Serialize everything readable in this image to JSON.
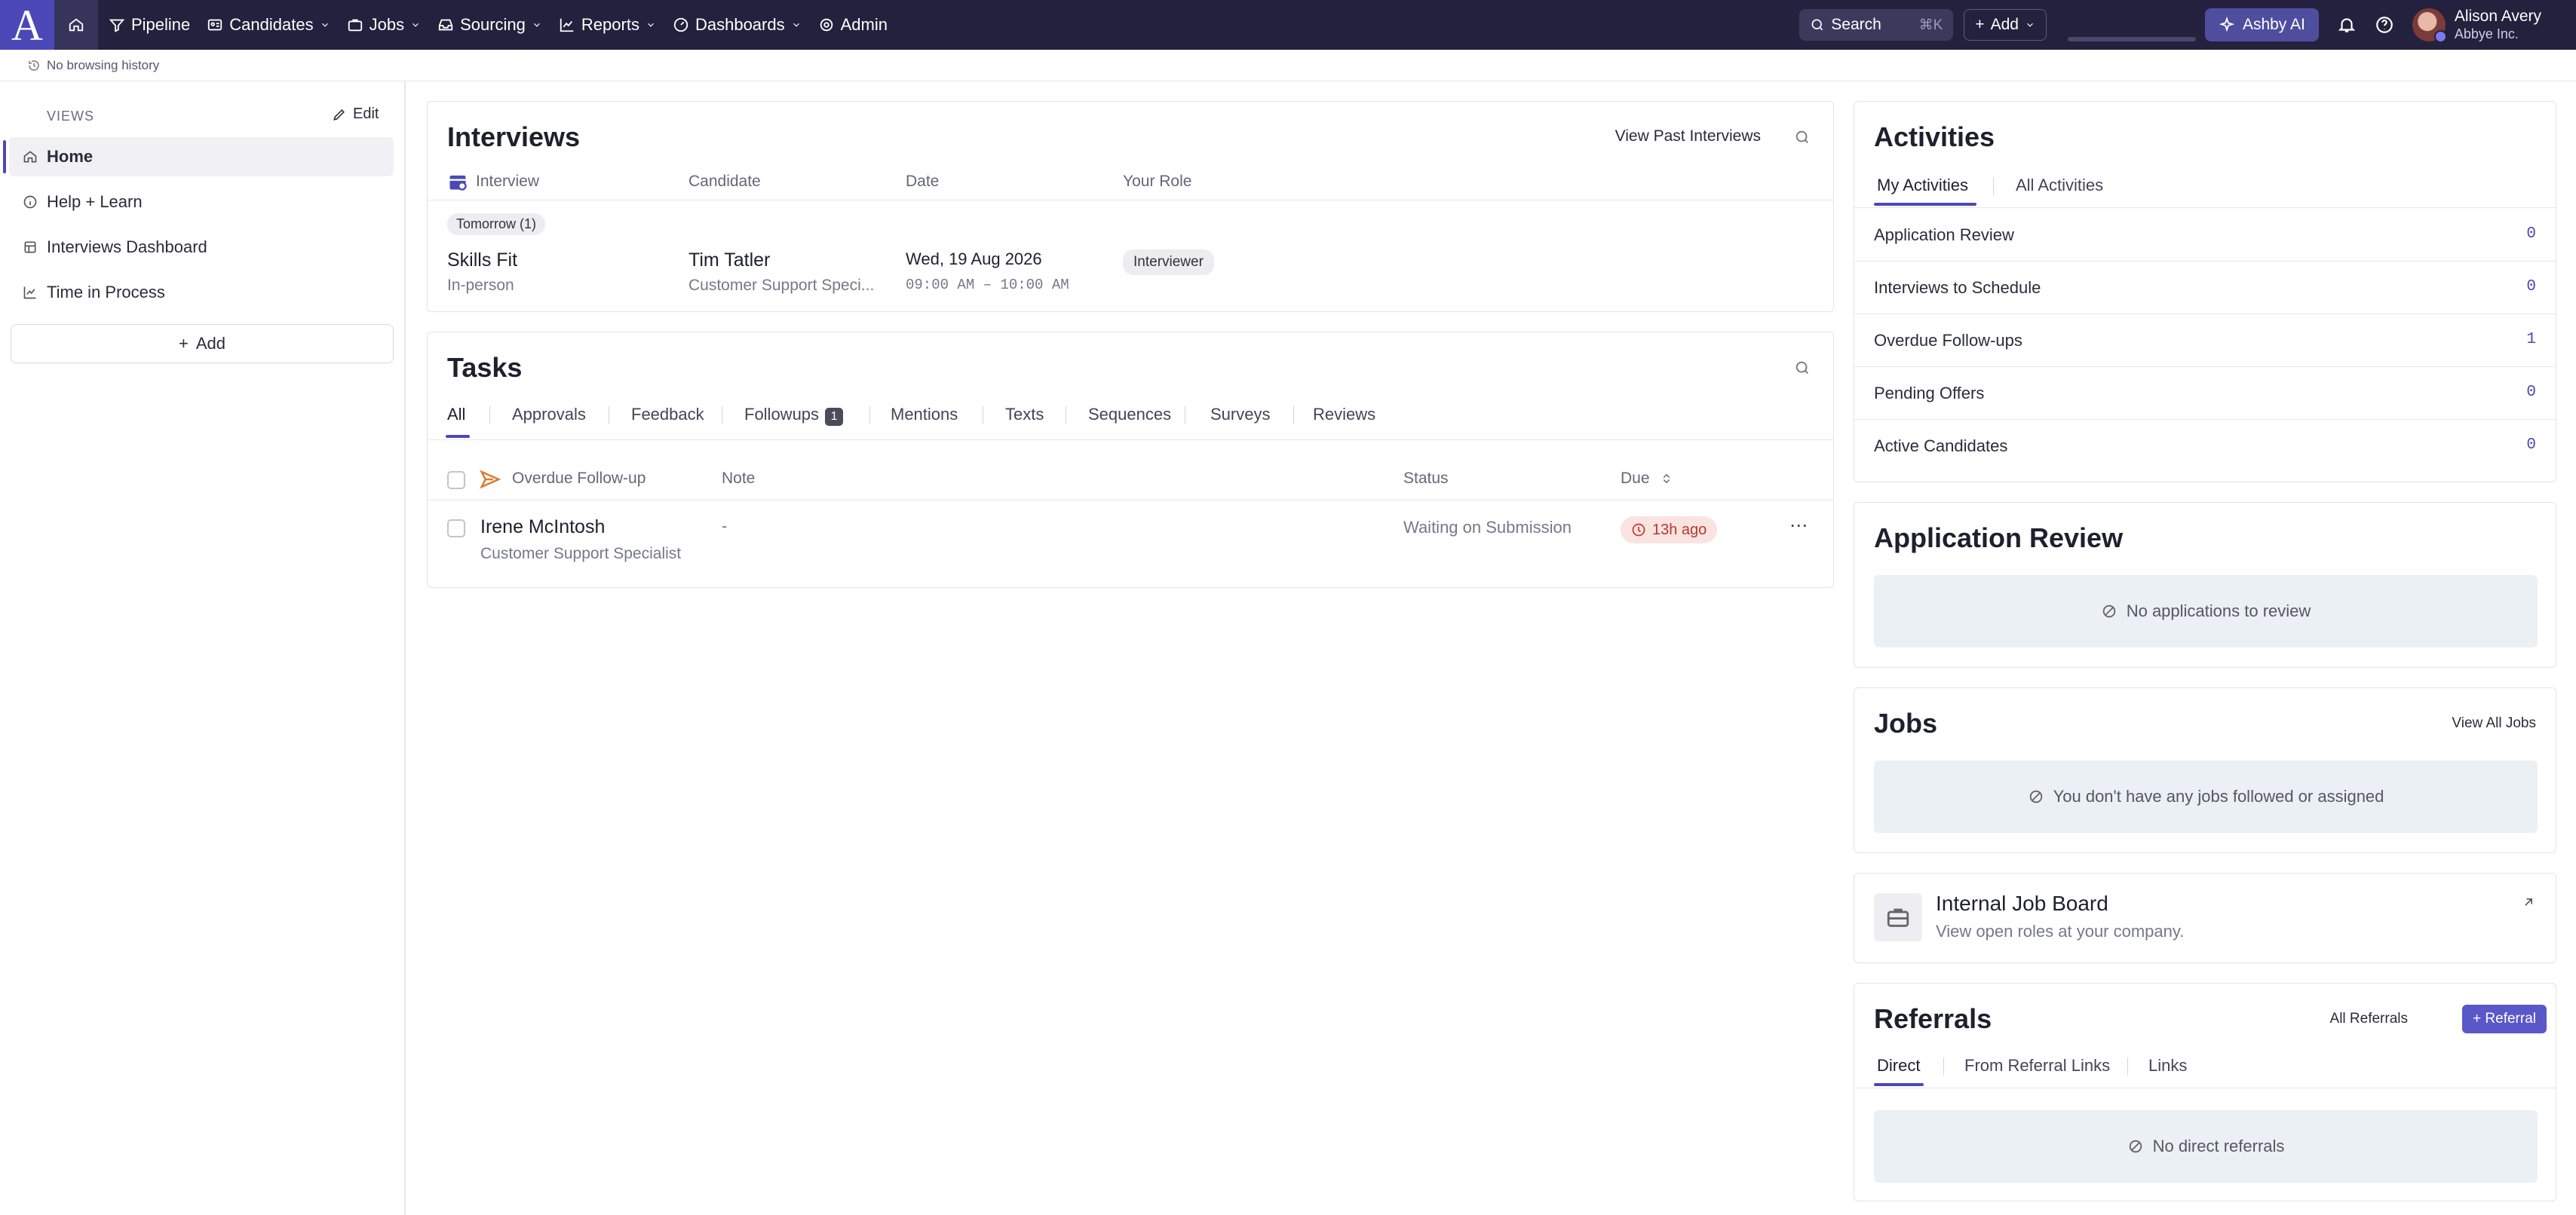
{
  "nav": {
    "logo": "A",
    "items": [
      {
        "label": "Pipeline"
      },
      {
        "label": "Candidates"
      },
      {
        "label": "Jobs"
      },
      {
        "label": "Sourcing"
      },
      {
        "label": "Reports"
      },
      {
        "label": "Dashboards"
      },
      {
        "label": "Admin"
      }
    ],
    "search_label": "Search",
    "search_shortcut": "⌘K",
    "add_label": "Add",
    "ai_label": "Ashby AI",
    "user_name": "Alison Avery",
    "user_org": "Abbye Inc."
  },
  "subbar": {
    "history": "No browsing history"
  },
  "sidebar": {
    "views_label": "VIEWS",
    "edit_label": "Edit",
    "items": [
      {
        "label": "Home"
      },
      {
        "label": "Help + Learn"
      },
      {
        "label": "Interviews Dashboard"
      },
      {
        "label": "Time in Process"
      }
    ],
    "add_label": "Add"
  },
  "interviews": {
    "title": "Interviews",
    "view_past": "View Past Interviews",
    "columns": [
      "Interview",
      "Candidate",
      "Date",
      "Your Role"
    ],
    "group_label": "Tomorrow (1)",
    "rows": [
      {
        "name": "Skills Fit",
        "type": "In-person",
        "candidate": "Tim Tatler",
        "job": "Customer Support Speci...",
        "date": "Wed, 19 Aug 2026",
        "time": "09:00 AM – 10:00 AM",
        "role": "Interviewer"
      }
    ]
  },
  "tasks": {
    "title": "Tasks",
    "tabs": [
      {
        "label": "All"
      },
      {
        "label": "Approvals"
      },
      {
        "label": "Feedback"
      },
      {
        "label": "Followups",
        "badge": "1"
      },
      {
        "label": "Mentions"
      },
      {
        "label": "Texts"
      },
      {
        "label": "Sequences"
      },
      {
        "label": "Surveys"
      },
      {
        "label": "Reviews"
      }
    ],
    "columns": [
      "Overdue Follow-up",
      "Note",
      "Status",
      "Due"
    ],
    "rows": [
      {
        "name": "Irene McIntosh",
        "job": "Customer Support Specialist",
        "note": "-",
        "status": "Waiting on Submission",
        "due": "13h ago"
      }
    ]
  },
  "activities": {
    "title": "Activities",
    "tabs": [
      {
        "label": "My Activities"
      },
      {
        "label": "All Activities"
      }
    ],
    "rows": [
      {
        "label": "Application Review",
        "value": "0"
      },
      {
        "label": "Interviews to Schedule",
        "value": "0"
      },
      {
        "label": "Overdue Follow-ups",
        "value": "1"
      },
      {
        "label": "Pending Offers",
        "value": "0"
      },
      {
        "label": "Active Candidates",
        "value": "0"
      }
    ]
  },
  "app_review": {
    "title": "Application Review",
    "empty": "No applications to review"
  },
  "jobs": {
    "title": "Jobs",
    "view_all": "View All Jobs",
    "empty": "You don't have any jobs followed or assigned"
  },
  "job_board": {
    "title": "Internal Job Board",
    "subtitle": "View open roles at your company."
  },
  "referrals": {
    "title": "Referrals",
    "all_link": "All Referrals",
    "button": "+ Referral",
    "tabs": [
      {
        "label": "Direct"
      },
      {
        "label": "From Referral Links"
      },
      {
        "label": "Links"
      }
    ],
    "empty": "No direct referrals"
  },
  "colors": {
    "accent": "#4b49b8",
    "nav_bg": "#23213d",
    "danger_bg": "#fbe3e1"
  }
}
